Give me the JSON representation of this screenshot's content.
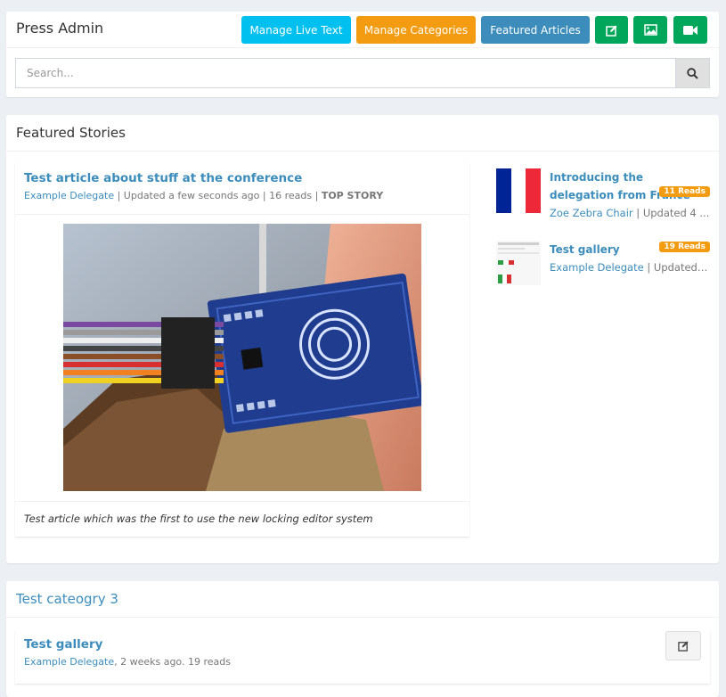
{
  "header": {
    "title": "Press Admin",
    "buttons": {
      "manage_live_text": "Manage Live Text",
      "manage_categories": "Manage Categories",
      "featured_articles": "Featured Articles"
    },
    "icon_buttons": [
      "edit-icon",
      "image-icon",
      "video-icon"
    ]
  },
  "search": {
    "placeholder": "Search...",
    "value": ""
  },
  "featured": {
    "title": "Featured Stories",
    "main": {
      "title": "Test article about stuff at the conference",
      "author": "Example Delegate",
      "updated": "Updated a few seconds ago",
      "reads": "16 reads",
      "tag": "TOP STORY",
      "summary": "Test article which was the first to use the new locking editor system"
    },
    "side": [
      {
        "title": "Introducing the delegation from France",
        "badge": "11 Reads",
        "author": "Zoe Zebra Chair",
        "updated": "Updated 4 ..."
      },
      {
        "title": "Test gallery",
        "badge": "19 Reads",
        "author": "Example Delegate",
        "updated": "Updated ..."
      }
    ]
  },
  "category": {
    "title": "Test cateogry 3",
    "item": {
      "title": "Test gallery",
      "author": "Example Delegate",
      "info": ", 2 weeks ago. 19 reads"
    }
  },
  "colors": {
    "info": "#00c0ef",
    "warning": "#f39c12",
    "primary": "#3c8dbc",
    "success": "#00a65a"
  }
}
